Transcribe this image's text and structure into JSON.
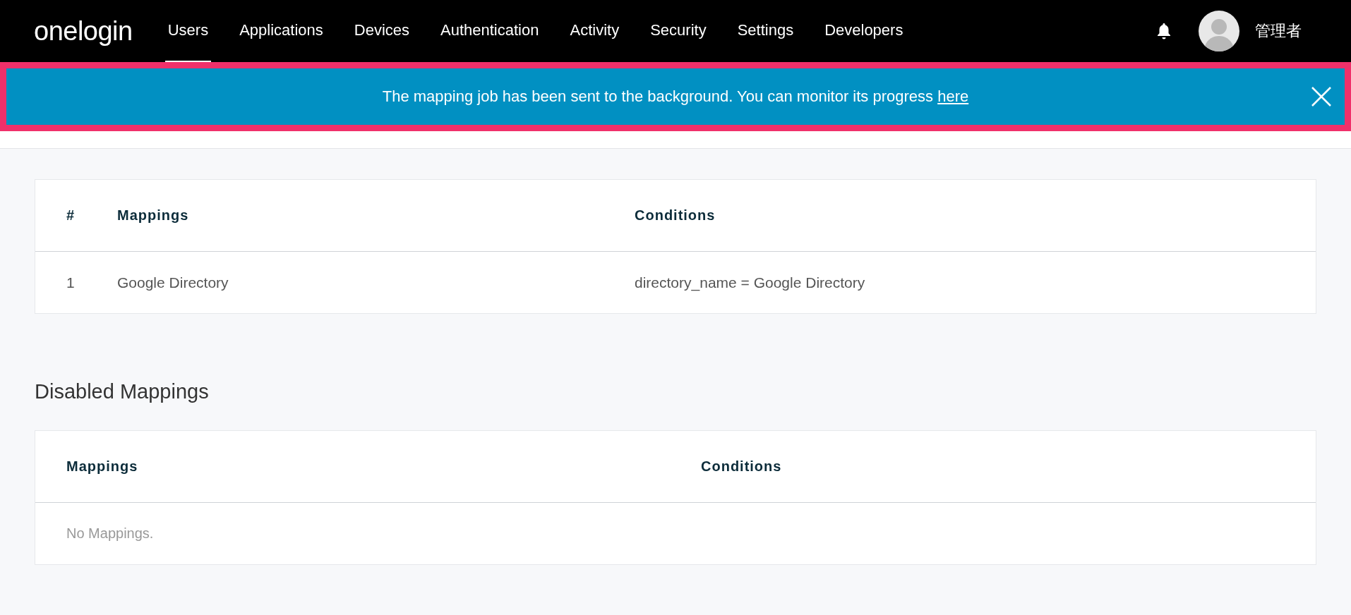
{
  "header": {
    "logo": "onelogin",
    "nav": [
      {
        "label": "Users",
        "selected": true
      },
      {
        "label": "Applications",
        "selected": false
      },
      {
        "label": "Devices",
        "selected": false
      },
      {
        "label": "Authentication",
        "selected": false
      },
      {
        "label": "Activity",
        "selected": false
      },
      {
        "label": "Security",
        "selected": false
      },
      {
        "label": "Settings",
        "selected": false
      },
      {
        "label": "Developers",
        "selected": false
      }
    ],
    "user_name": "管理者"
  },
  "banner": {
    "message": "The mapping job has been sent to the background. You can monitor its progress ",
    "link": "here"
  },
  "mappings_table": {
    "columns": [
      "#",
      "Mappings",
      "Conditions"
    ],
    "rows": [
      [
        "1",
        "Google Directory",
        "directory_name = Google Directory"
      ]
    ]
  },
  "disabled_section": {
    "title": "Disabled Mappings",
    "columns": [
      "Mappings",
      "Conditions"
    ],
    "empty_text": "No Mappings."
  }
}
